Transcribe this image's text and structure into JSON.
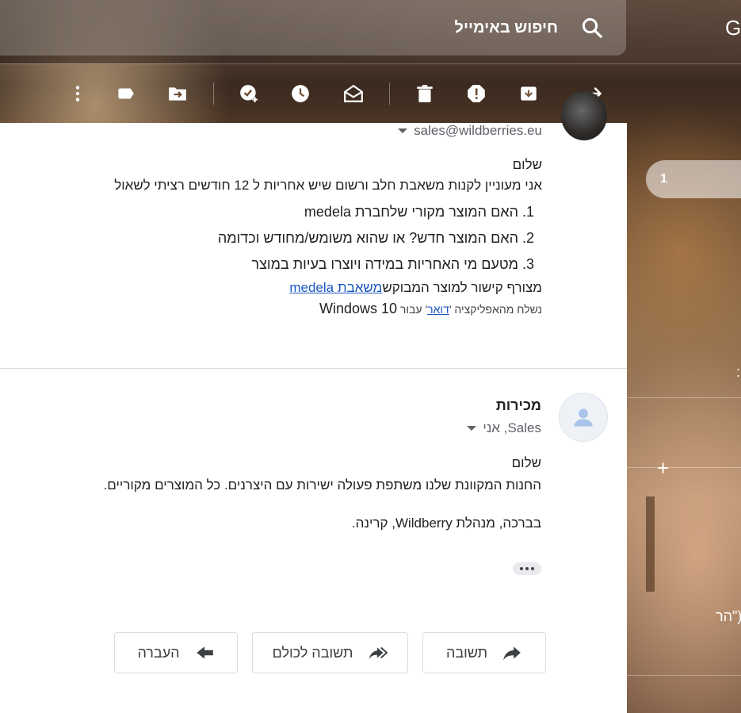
{
  "search": {
    "placeholder": "חיפוש באימייל"
  },
  "header": {
    "account_letter": "G"
  },
  "toolbar": {
    "items": [
      "back-arrow",
      "archive",
      "report-spam",
      "delete",
      "mark-unread",
      "snooze",
      "add-to-tasks",
      "move-to",
      "label",
      "more"
    ]
  },
  "message1": {
    "sender_email": "sales@wildberries.eu",
    "greeting": "שלום",
    "intro": "אני מעוניין לקנות משאבת חלב ורשום שיש אחריות ל 12 חודשים רציתי לשאול",
    "questions": [
      "האם המוצר מקורי שלחברת medela",
      "האם המוצר חדש? או שהוא משומש/מחודש וכדומה",
      "מטעם מי האחריות במידה ויוצרו בעיות במוצר"
    ],
    "link_prefix": "מצורף קישור למוצר המבוקש",
    "link_text": "משאבת medela",
    "sent_from_prefix": "נשלח מהאפליקציה '",
    "sent_from_app": "דואר",
    "sent_from_mid": "' עבור ",
    "sent_from_os": "Windows 10"
  },
  "message2": {
    "sender_name": "מכירות",
    "recipients": "Sales, אני",
    "greeting": "שלום",
    "line1": "החנות המקוונת שלנו משתפת פעולה ישירות עם היצרנים. כל המוצרים מקוריים.",
    "signature": "בברכה, מנהלת Wildberry, קרינה."
  },
  "actions": {
    "reply": "תשובה",
    "reply_all": "תשובה לכולם",
    "forward": "העברה"
  },
  "right_panel": {
    "count": "1",
    "partial_text": "הר\")",
    "side_mark": ":"
  },
  "colors": {
    "link": "#1a55c0",
    "muted": "#5f6368",
    "border": "#dadce0"
  }
}
